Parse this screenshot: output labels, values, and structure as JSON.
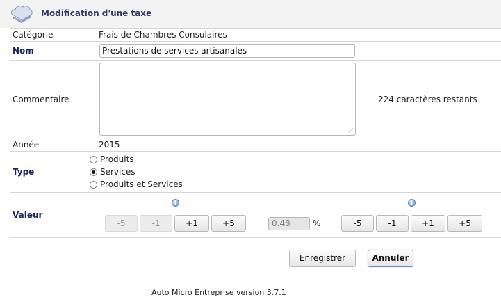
{
  "header": {
    "title": "Modification d'une taxe"
  },
  "fields": {
    "categorie": {
      "label": "Catégorie",
      "value": "Frais de Chambres Consulaires"
    },
    "nom": {
      "label": "Nom",
      "value": "Prestations de services artisanales"
    },
    "commentaire": {
      "label": "Commentaire",
      "value": "",
      "remaining": "224 caractères restants"
    },
    "annee": {
      "label": "Année",
      "value": "2015"
    },
    "type": {
      "label": "Type",
      "options": [
        "Produits",
        "Services",
        "Produits et Services"
      ],
      "selected": "Services"
    },
    "valeur": {
      "label": "Valeur",
      "left_buttons": [
        "-5",
        "-1",
        "+1",
        "+5"
      ],
      "value": "0.48",
      "unit": "%",
      "right_buttons": [
        "-5",
        "-1",
        "+1",
        "+5"
      ]
    }
  },
  "actions": {
    "save": "Enregistrer",
    "cancel": "Annuler"
  },
  "footer": {
    "version": "Auto Micro Entreprise version 3.7.1"
  },
  "colors": {
    "label_bold": "#1b2559",
    "header_bg": "#f3f3f3",
    "border": "#d6d6d6"
  },
  "icons": {
    "logo": "cloud-folder-icon",
    "info": "info-icon"
  }
}
